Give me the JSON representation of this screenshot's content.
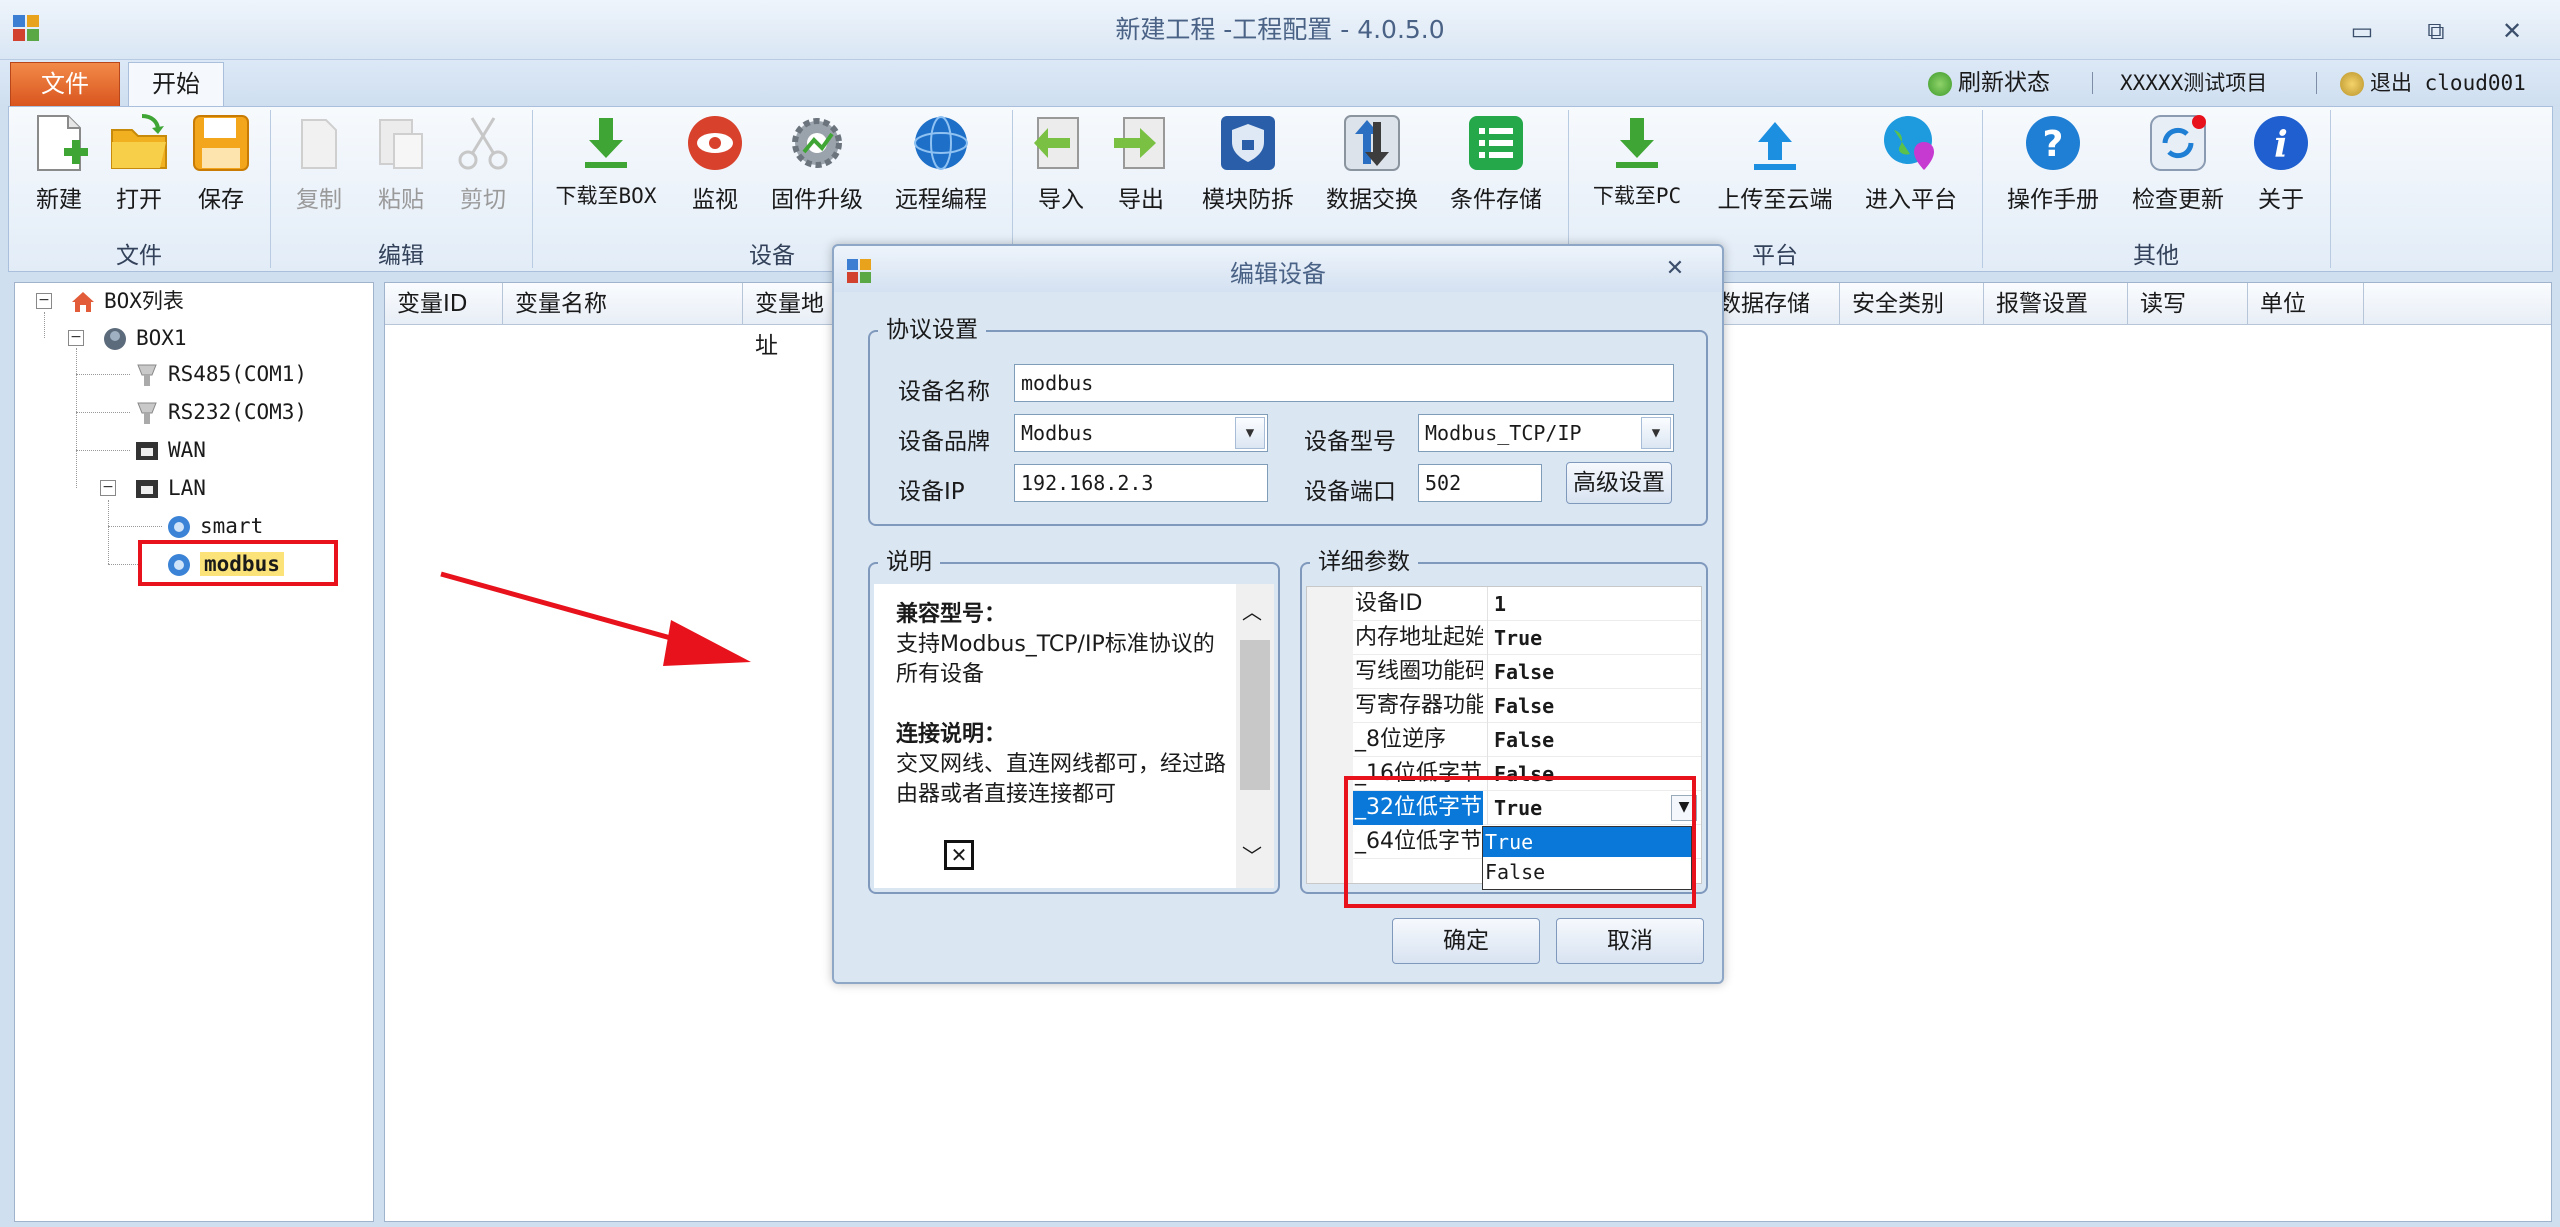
{
  "window": {
    "title": "新建工程 -工程配置 - 4.0.5.0",
    "minimize": "▭",
    "maximize": "⧉",
    "close": "✕"
  },
  "tabs": {
    "file": "文件",
    "home": "开始"
  },
  "top_links": {
    "refresh": "刷新状态",
    "project": "XXXXX测试项目",
    "logout": "退出 cloud001"
  },
  "ribbon": {
    "groups": {
      "file": "文件",
      "edit": "编辑",
      "device": "设备",
      "platform": "平台",
      "other": "其他"
    },
    "buttons": {
      "new": "新建",
      "open": "打开",
      "save": "保存",
      "copy": "复制",
      "paste": "粘贴",
      "cut": "剪切",
      "download_box": "下载至BOX",
      "monitor": "监视",
      "firmware": "固件升级",
      "remote": "远程编程",
      "import": "导入",
      "export": "导出",
      "module": "模块防拆",
      "exchange": "数据交换",
      "condition": "条件存储",
      "download_pc": "下载至PC",
      "upload_cloud": "上传至云端",
      "enter_platform": "进入平台",
      "manual": "操作手册",
      "update": "检查更新",
      "about": "关于"
    },
    "icon_names": {
      "new": "new-doc-icon",
      "open": "folder-icon",
      "save": "save-icon",
      "copy": "copy-icon",
      "paste": "paste-icon",
      "cut": "scissors-icon"
    }
  },
  "tree": {
    "root": "BOX列表",
    "box": "BOX1",
    "rs485": "RS485(COM1)",
    "rs232": "RS232(COM3)",
    "wan": "WAN",
    "lan": "LAN",
    "smart": "smart",
    "modbus": "modbus"
  },
  "grid": {
    "columns": [
      "变量ID",
      "变量名称",
      "变量地址",
      "数据存储",
      "安全类别",
      "报警设置",
      "读写",
      "单位"
    ]
  },
  "dialog": {
    "title": "编辑设备",
    "close": "✕",
    "protocol_legend": "协议设置",
    "device_name_label": "设备名称",
    "device_name": "modbus",
    "brand_label": "设备品牌",
    "brand": "Modbus",
    "model_label": "设备型号",
    "model": "Modbus_TCP/IP",
    "ip_label": "设备IP",
    "ip": "192.168.2.3",
    "port_label": "设备端口",
    "port": "502",
    "advanced": "高级设置",
    "desc_legend": "说明",
    "desc_h1": "兼容型号：",
    "desc_p1": "支持Modbus_TCP/IP标准协议的所有设备",
    "desc_h2": "连接说明：",
    "desc_p2": "交叉网线、直连网线都可，经过路由器或者直接连接都可",
    "detail_legend": "详细参数",
    "params": [
      {
        "name": "设备ID",
        "value": "1"
      },
      {
        "name": "内存地址起始",
        "value": "True"
      },
      {
        "name": "写线圈功能码",
        "value": "False"
      },
      {
        "name": "写寄存器功能码",
        "value": "False"
      },
      {
        "name": "_8位逆序",
        "value": "False"
      },
      {
        "name": "_16位低字节",
        "value": "False"
      },
      {
        "name": "_32位低字节",
        "value": "True"
      },
      {
        "name": "_64位低字节",
        "value": ""
      }
    ],
    "dropdown_options": [
      "True",
      "False"
    ],
    "ok": "确定",
    "cancel": "取消"
  },
  "colors": {
    "accent": "#0a78d8",
    "highlight_red": "#e8121c",
    "file_tab": "#e0642a"
  }
}
